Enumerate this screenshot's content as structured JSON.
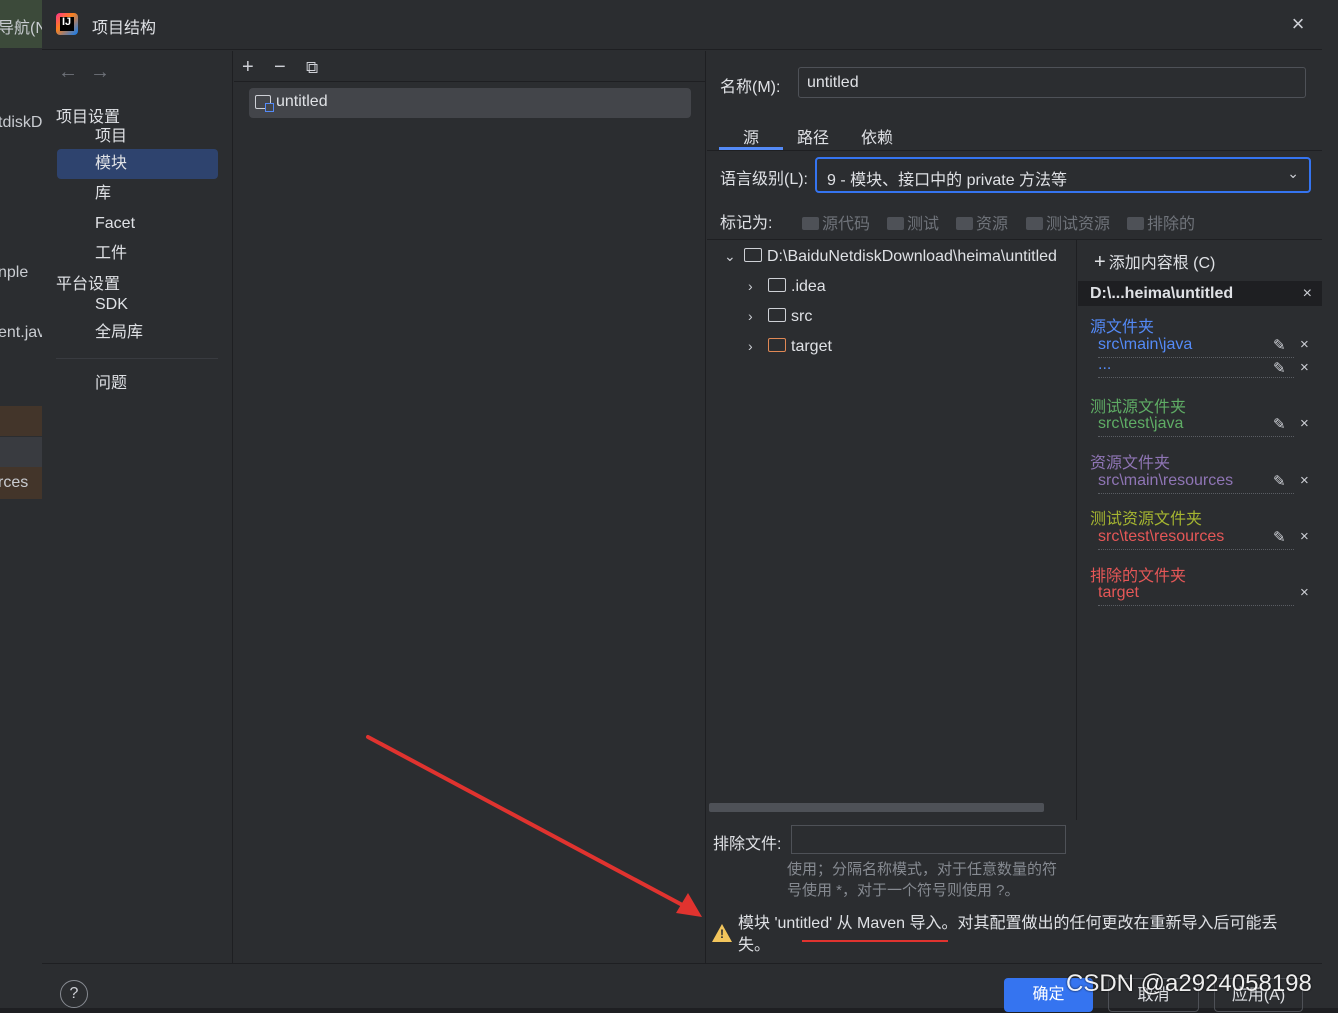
{
  "background_ide": {
    "fragments": [
      "导航(N",
      "tdiskD",
      "nple",
      "ent.jav",
      "rces"
    ]
  },
  "dialog": {
    "title": "项目结构",
    "close_icon": "×"
  },
  "nav": {
    "back_icon": "←",
    "forward_icon": "→",
    "project_settings_header": "项目设置",
    "items_project": [
      "项目",
      "模块",
      "库",
      "Facet",
      "工件"
    ],
    "platform_settings_header": "平台设置",
    "items_platform": [
      "SDK",
      "全局库"
    ],
    "problems": "问题",
    "selected": "模块"
  },
  "modules": {
    "add_icon": "+",
    "remove_icon": "−",
    "copy_icon": "⧉",
    "list": [
      "untitled"
    ]
  },
  "details": {
    "name_label": "名称(M):",
    "name_value": "untitled",
    "tabs": [
      "源",
      "路径",
      "依赖"
    ],
    "active_tab": "源",
    "language_level_label": "语言级别(L):",
    "language_level_value": "9 - 模块、接口中的 private 方法等",
    "mark_as_label": "标记为:",
    "mark_buttons": [
      "源代码",
      "测试",
      "资源",
      "测试资源",
      "排除的"
    ],
    "tree": {
      "root": "D:\\BaiduNetdiskDownload\\heima\\untitled",
      "children": [
        ".idea",
        "src",
        "target"
      ]
    },
    "roots_panel": {
      "add_content_root": "添加内容根 (C)",
      "root_header": "D:\\...heima\\untitled",
      "source_title": "源文件夹",
      "source_entries": [
        "src\\main\\java",
        "..."
      ],
      "test_source_title": "测试源文件夹",
      "test_source_entries": [
        "src\\test\\java"
      ],
      "resource_title": "资源文件夹",
      "resource_entries": [
        "src\\main\\resources"
      ],
      "test_resource_title": "测试资源文件夹",
      "test_resource_entries": [
        "src\\test\\resources"
      ],
      "excluded_title": "排除的文件夹",
      "excluded_entries": [
        "target"
      ]
    },
    "exclude_files_label": "排除文件:",
    "exclude_files_value": "",
    "exclude_hint": "使用；分隔名称模式，对于任意数量的符号使用 *，对于一个符号则使用 ?。",
    "warning": "模块 'untitled' 从 Maven 导入。对其配置做出的任何更改在重新导入后可能丢失。"
  },
  "buttons": {
    "help": "?",
    "ok": "确定",
    "cancel": "取消",
    "apply": "应用(A)"
  },
  "watermark": "CSDN @a2924058198",
  "colors": {
    "accent": "#3574f0",
    "source": "#548af7",
    "test_source": "#5fad65",
    "resource": "#8f75b5",
    "test_resource": "#a5b530",
    "excluded": "#e55757",
    "test_resource_entry": "#e55757",
    "annotation": "#e0332f"
  }
}
